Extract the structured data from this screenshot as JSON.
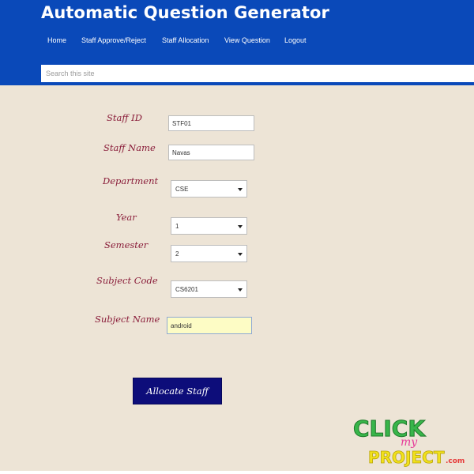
{
  "header": {
    "title": "Automatic Question Generator",
    "nav": [
      "Home",
      "Staff Approve/Reject",
      "Staff Allocation",
      "View Question",
      "Logout"
    ],
    "search_placeholder": "Search this site"
  },
  "form": {
    "staff_id": {
      "label": "Staff ID",
      "value": "STF01"
    },
    "staff_name": {
      "label": "Staff Name",
      "value": "Navas"
    },
    "department": {
      "label": "Department",
      "value": "CSE"
    },
    "year": {
      "label": "Year",
      "value": "1"
    },
    "semester": {
      "label": "Semester",
      "value": "2"
    },
    "subject_code": {
      "label": "Subject Code",
      "value": "CS6201"
    },
    "subject_name": {
      "label": "Subject Name",
      "value": "android"
    },
    "submit_label": "Allocate Staff"
  },
  "logo": {
    "line1": "CLICK",
    "line2": "my",
    "line3": "PROJECT",
    "suffix": ".com"
  },
  "colors": {
    "header_bg": "#0a49b9",
    "content_bg": "#ede4d6",
    "label": "#8a1d3a",
    "button_bg": "#0d0d7a",
    "highlight_field": "#fdfcc5"
  }
}
